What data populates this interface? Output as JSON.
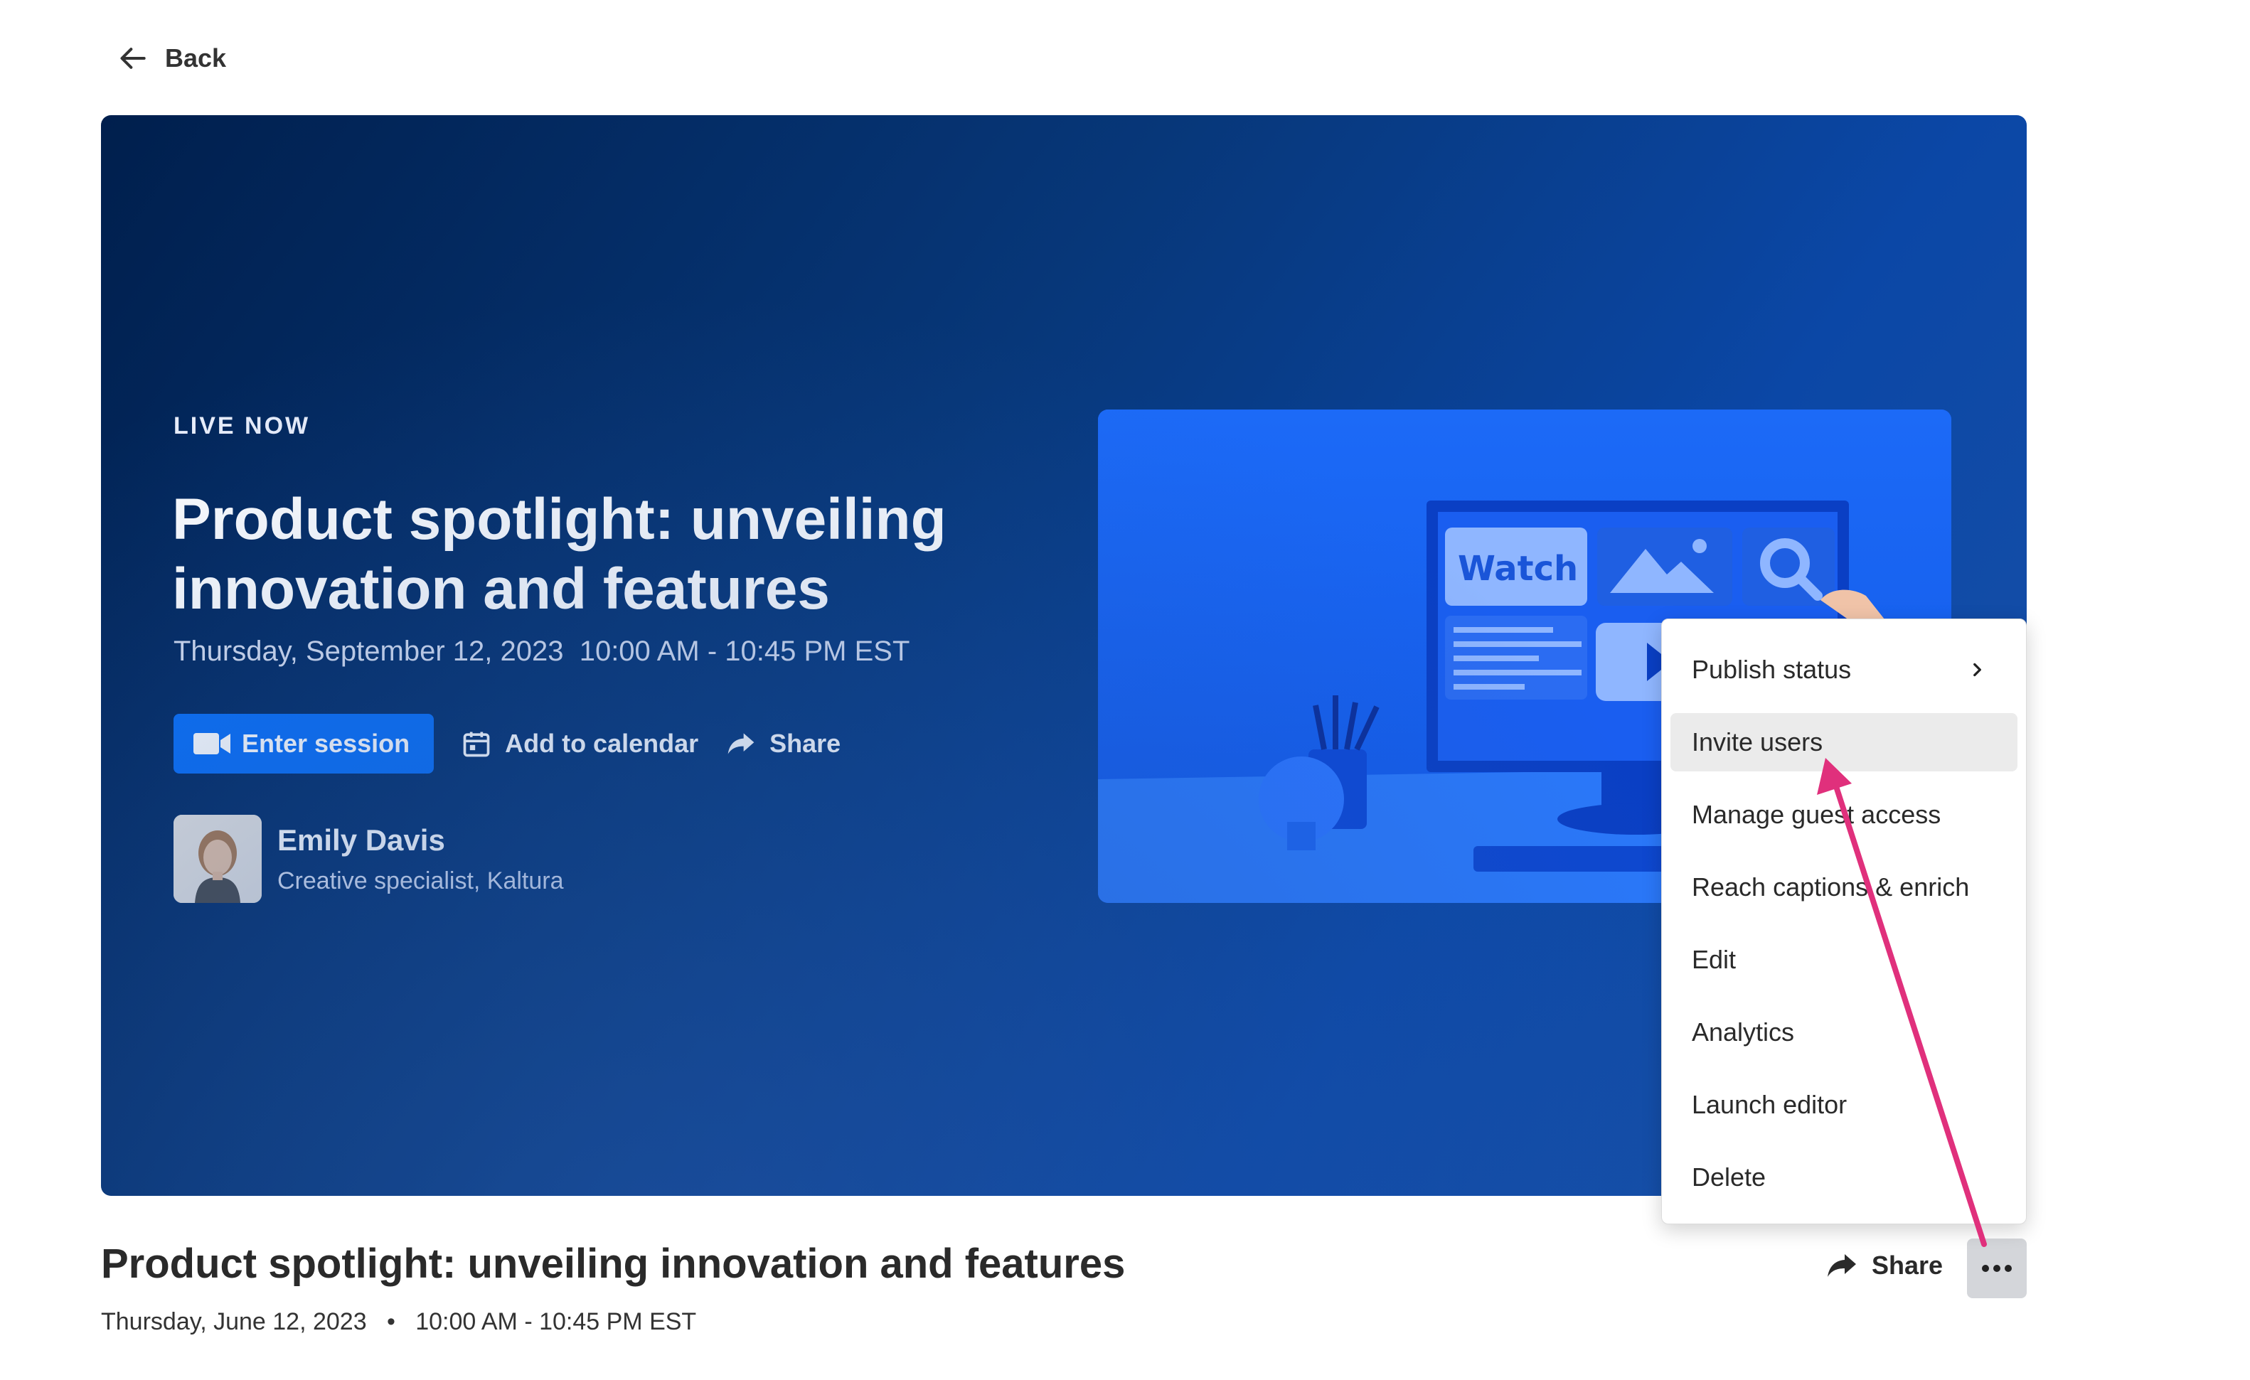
{
  "back": {
    "label": "Back"
  },
  "hero": {
    "status": "LIVE NOW",
    "title": "Product spotlight: unveiling innovation and features",
    "date_time": "Thursday, September 12, 2023  10:00 AM - 10:45 PM EST",
    "actions": {
      "enter_session": "Enter session",
      "add_to_calendar": "Add to calendar",
      "share": "Share"
    },
    "presenter": {
      "name": "Emily Davis",
      "role": "Creative specialist, Kaltura"
    },
    "thumbnail": {
      "screen_label": "Watch"
    }
  },
  "menu": {
    "items": [
      {
        "label": "Publish status",
        "has_submenu": true
      },
      {
        "label": "Invite users",
        "highlighted": true
      },
      {
        "label": "Manage guest access"
      },
      {
        "label": "Reach captions & enrich"
      },
      {
        "label": "Edit"
      },
      {
        "label": "Analytics"
      },
      {
        "label": "Launch editor"
      },
      {
        "label": "Delete"
      }
    ]
  },
  "entry": {
    "title": "Product spotlight: unveiling innovation and features",
    "date": "Thursday, June 12, 2023",
    "separator": "•",
    "time": "10:00 AM - 10:45 PM EST",
    "share": "Share"
  },
  "colors": {
    "primary_button": "#0a6ef5",
    "annotation_arrow": "#e0307c",
    "hero_gradient_start": "#001f4d",
    "hero_gradient_end": "#1a52a8"
  }
}
